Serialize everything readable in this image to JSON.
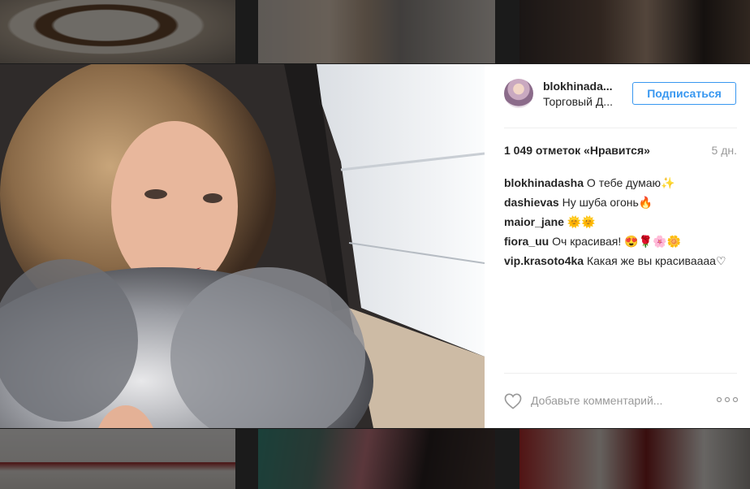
{
  "post": {
    "username": "blokhinadasha",
    "username_short": "blokhinada...",
    "location_short": "Торговый Д...",
    "follow_label": "Подписаться",
    "likes_text": "1 049 отметок «Нравится»",
    "time_ago": "5 дн.",
    "comments": [
      {
        "user": "blokhinadasha",
        "text": "О тебе думаю✨"
      },
      {
        "user": "dashievas",
        "text": "Ну шуба огонь🔥"
      },
      {
        "user": "maior_jane",
        "text": "🌞🌞"
      },
      {
        "user": "fiora_uu",
        "text": "Оч красивая! 😍🌹🌸🌼"
      },
      {
        "user": "vip.krasoto4ka",
        "text": "Какая же вы красиваааа♡"
      }
    ],
    "add_comment_placeholder": "Добавьте комментарий..."
  },
  "icons": {
    "like": "heart-icon",
    "more": "more-options-icon"
  },
  "colors": {
    "accent": "#3897f0",
    "text": "#262626",
    "muted": "#999999"
  }
}
